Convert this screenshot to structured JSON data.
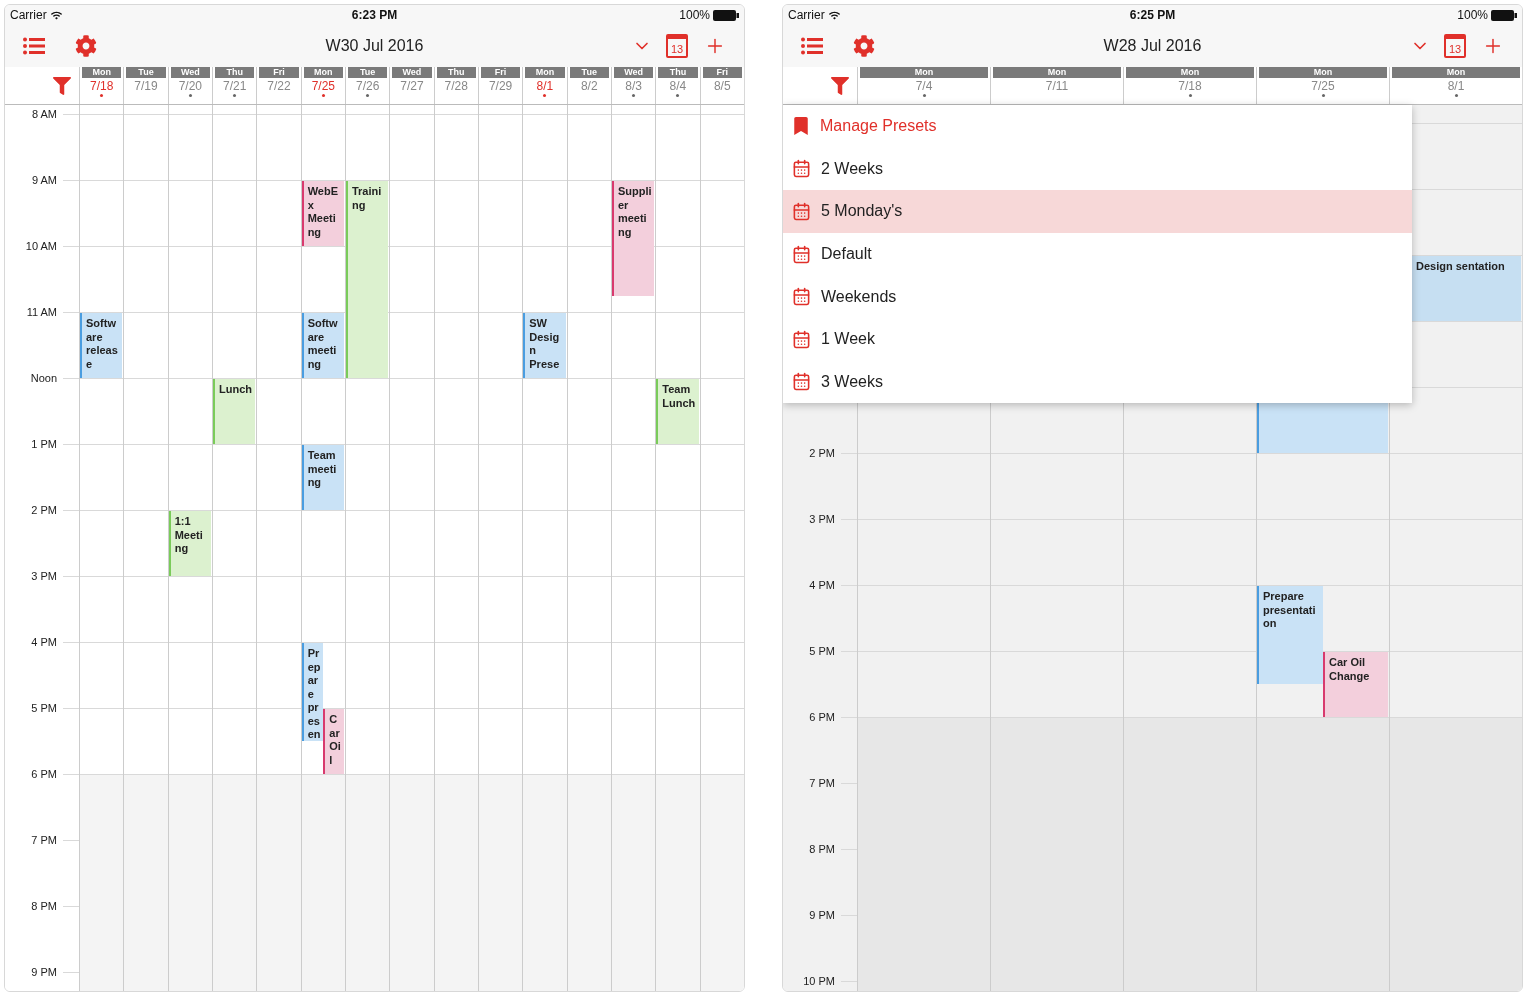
{
  "screens": [
    {
      "status_bar": {
        "carrier": "Carrier",
        "time": "6:23 PM",
        "battery": "100%"
      },
      "nav": {
        "title": "W30 Jul 2016",
        "calendar_day": "13"
      },
      "days": [
        {
          "weekday": "Mon",
          "date": "7/18",
          "highlighted": true,
          "has_events": true,
          "events": [
            {
              "text": "Software release",
              "color": "#4a9de0"
            }
          ]
        },
        {
          "weekday": "Tue",
          "date": "7/19",
          "highlighted": false,
          "has_events": false
        },
        {
          "weekday": "Wed",
          "date": "7/20",
          "highlighted": false,
          "has_events": true,
          "events": [
            {
              "text": "1:1 Meeting",
              "color": "#7acb5a"
            }
          ]
        },
        {
          "weekday": "Thu",
          "date": "7/21",
          "highlighted": false,
          "has_events": true,
          "events": [
            {
              "text": "Lunch",
              "color": "#7acb5a"
            }
          ]
        },
        {
          "weekday": "Fri",
          "date": "7/22",
          "highlighted": false,
          "has_events": false
        },
        {
          "weekday": "Mon",
          "date": "7/25",
          "highlighted": true,
          "has_events": true,
          "events": [
            {
              "text": "WebEx Meeting",
              "color": "#d83a6e"
            },
            {
              "text": "Software meeting",
              "color": "#4a9de0"
            },
            {
              "text": "Team meeting",
              "color": "#4a9de0"
            },
            {
              "text": "Prepare presen",
              "color": "#4a9de0"
            },
            {
              "text": "Car Oil",
              "color": "#d83a6e"
            }
          ]
        },
        {
          "weekday": "Tue",
          "date": "7/26",
          "highlighted": false,
          "has_events": true,
          "events": [
            {
              "text": "Training",
              "color": "#7acb5a"
            }
          ]
        },
        {
          "weekday": "Wed",
          "date": "7/27",
          "highlighted": false,
          "has_events": false
        },
        {
          "weekday": "Thu",
          "date": "7/28",
          "highlighted": false,
          "has_events": false
        },
        {
          "weekday": "Fri",
          "date": "7/29",
          "highlighted": false,
          "has_events": false
        },
        {
          "weekday": "Mon",
          "date": "8/1",
          "highlighted": true,
          "has_events": true,
          "events": [
            {
              "text": "SW Design Prese",
              "color": "#4a9de0"
            }
          ]
        },
        {
          "weekday": "Tue",
          "date": "8/2",
          "highlighted": false,
          "has_events": false
        },
        {
          "weekday": "Wed",
          "date": "8/3",
          "highlighted": false,
          "has_events": true,
          "events": [
            {
              "text": "Supplier meeting",
              "color": "#d83a6e"
            }
          ]
        },
        {
          "weekday": "Thu",
          "date": "8/4",
          "highlighted": false,
          "has_events": true,
          "events": [
            {
              "text": "Team Lunch",
              "color": "#7acb5a"
            }
          ]
        },
        {
          "weekday": "Fri",
          "date": "8/5",
          "highlighted": false,
          "has_events": false
        }
      ],
      "time_labels": [
        "8 AM",
        "9 AM",
        "10 AM",
        "11 AM",
        "Noon",
        "1 PM",
        "2 PM",
        "3 PM",
        "4 PM",
        "5 PM",
        "6 PM",
        "7 PM",
        "8 PM",
        "9 PM"
      ]
    },
    {
      "status_bar": {
        "carrier": "Carrier",
        "time": "6:25 PM",
        "battery": "100%"
      },
      "nav": {
        "title": "W28 Jul 2016",
        "calendar_day": "13"
      },
      "days": [
        {
          "weekday": "Mon",
          "date": "7/4",
          "highlighted": false,
          "has_events": true
        },
        {
          "weekday": "Mon",
          "date": "7/11",
          "highlighted": false,
          "has_events": false
        },
        {
          "weekday": "Mon",
          "date": "7/18",
          "highlighted": false,
          "has_events": true
        },
        {
          "weekday": "Mon",
          "date": "7/25",
          "highlighted": false,
          "has_events": true,
          "events": [
            {
              "color": "#4a9de0"
            },
            {
              "text": "Prepare presentation",
              "color": "#4a9de0"
            },
            {
              "text": "Car Oil Change",
              "color": "#d83a6e"
            }
          ]
        },
        {
          "weekday": "Mon",
          "date": "8/1",
          "highlighted": false,
          "has_events": true,
          "events": [
            {
              "text": "Design sentation",
              "kind": "clipped",
              "color": "#c6dff2"
            }
          ]
        }
      ],
      "time_labels": [
        "2 PM",
        "3 PM",
        "4 PM",
        "5 PM",
        "6 PM",
        "7 PM",
        "8 PM",
        "9 PM",
        "10 PM"
      ],
      "preset_menu": [
        {
          "label": "Manage Presets",
          "kind": "action",
          "selected": false
        },
        {
          "label": "2 Weeks",
          "kind": "preset",
          "selected": false
        },
        {
          "label": "5 Monday's",
          "kind": "preset",
          "selected": true
        },
        {
          "label": "Default",
          "kind": "preset",
          "selected": false
        },
        {
          "label": "Weekends",
          "kind": "preset",
          "selected": false
        },
        {
          "label": "1 Week",
          "kind": "preset",
          "selected": false
        },
        {
          "label": "3 Weeks",
          "kind": "preset",
          "selected": false
        }
      ]
    }
  ]
}
